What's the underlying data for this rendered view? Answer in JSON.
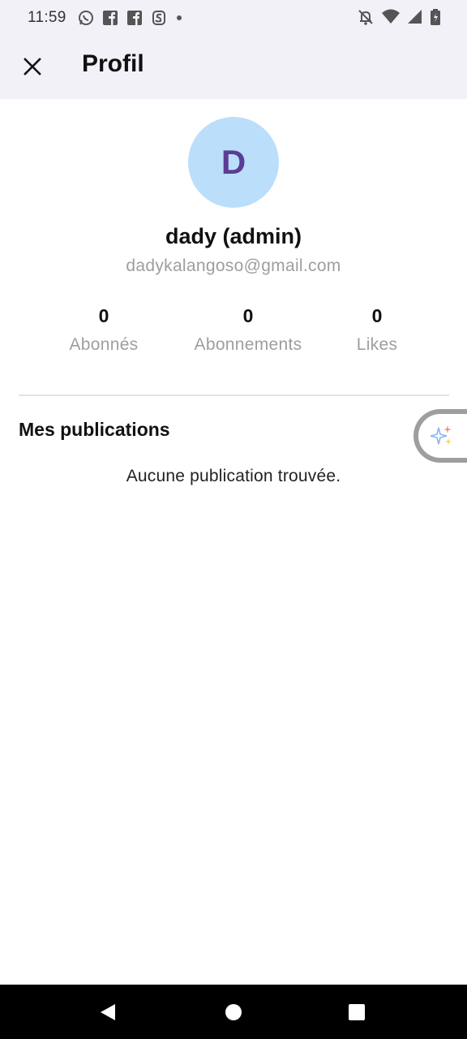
{
  "status_bar": {
    "time": "11:59",
    "left_icons": [
      "whatsapp-icon",
      "facebook-icon",
      "facebook-icon",
      "app-notification-icon",
      "dot-icon"
    ],
    "right_icons": [
      "notifications-off-icon",
      "wifi-icon",
      "signal-icon",
      "battery-icon"
    ]
  },
  "app_bar": {
    "title": "Profil",
    "close_icon": "close-icon"
  },
  "profile": {
    "avatar_initial": "D",
    "avatar_bg": "#bbdefb",
    "avatar_text_color": "#5a3e94",
    "name": "dady (admin)",
    "email": "dadykalangoso@gmail.com"
  },
  "stats": [
    {
      "value": "0",
      "label": "Abonnés"
    },
    {
      "value": "0",
      "label": "Abonnements"
    },
    {
      "value": "0",
      "label": "Likes"
    }
  ],
  "publications": {
    "title": "Mes publications",
    "empty_message": "Aucune publication trouvée."
  },
  "floating_bubble": {
    "icon": "sparkle-icon"
  },
  "nav_bar": {
    "buttons": [
      "back-icon",
      "home-icon",
      "recents-icon"
    ]
  }
}
